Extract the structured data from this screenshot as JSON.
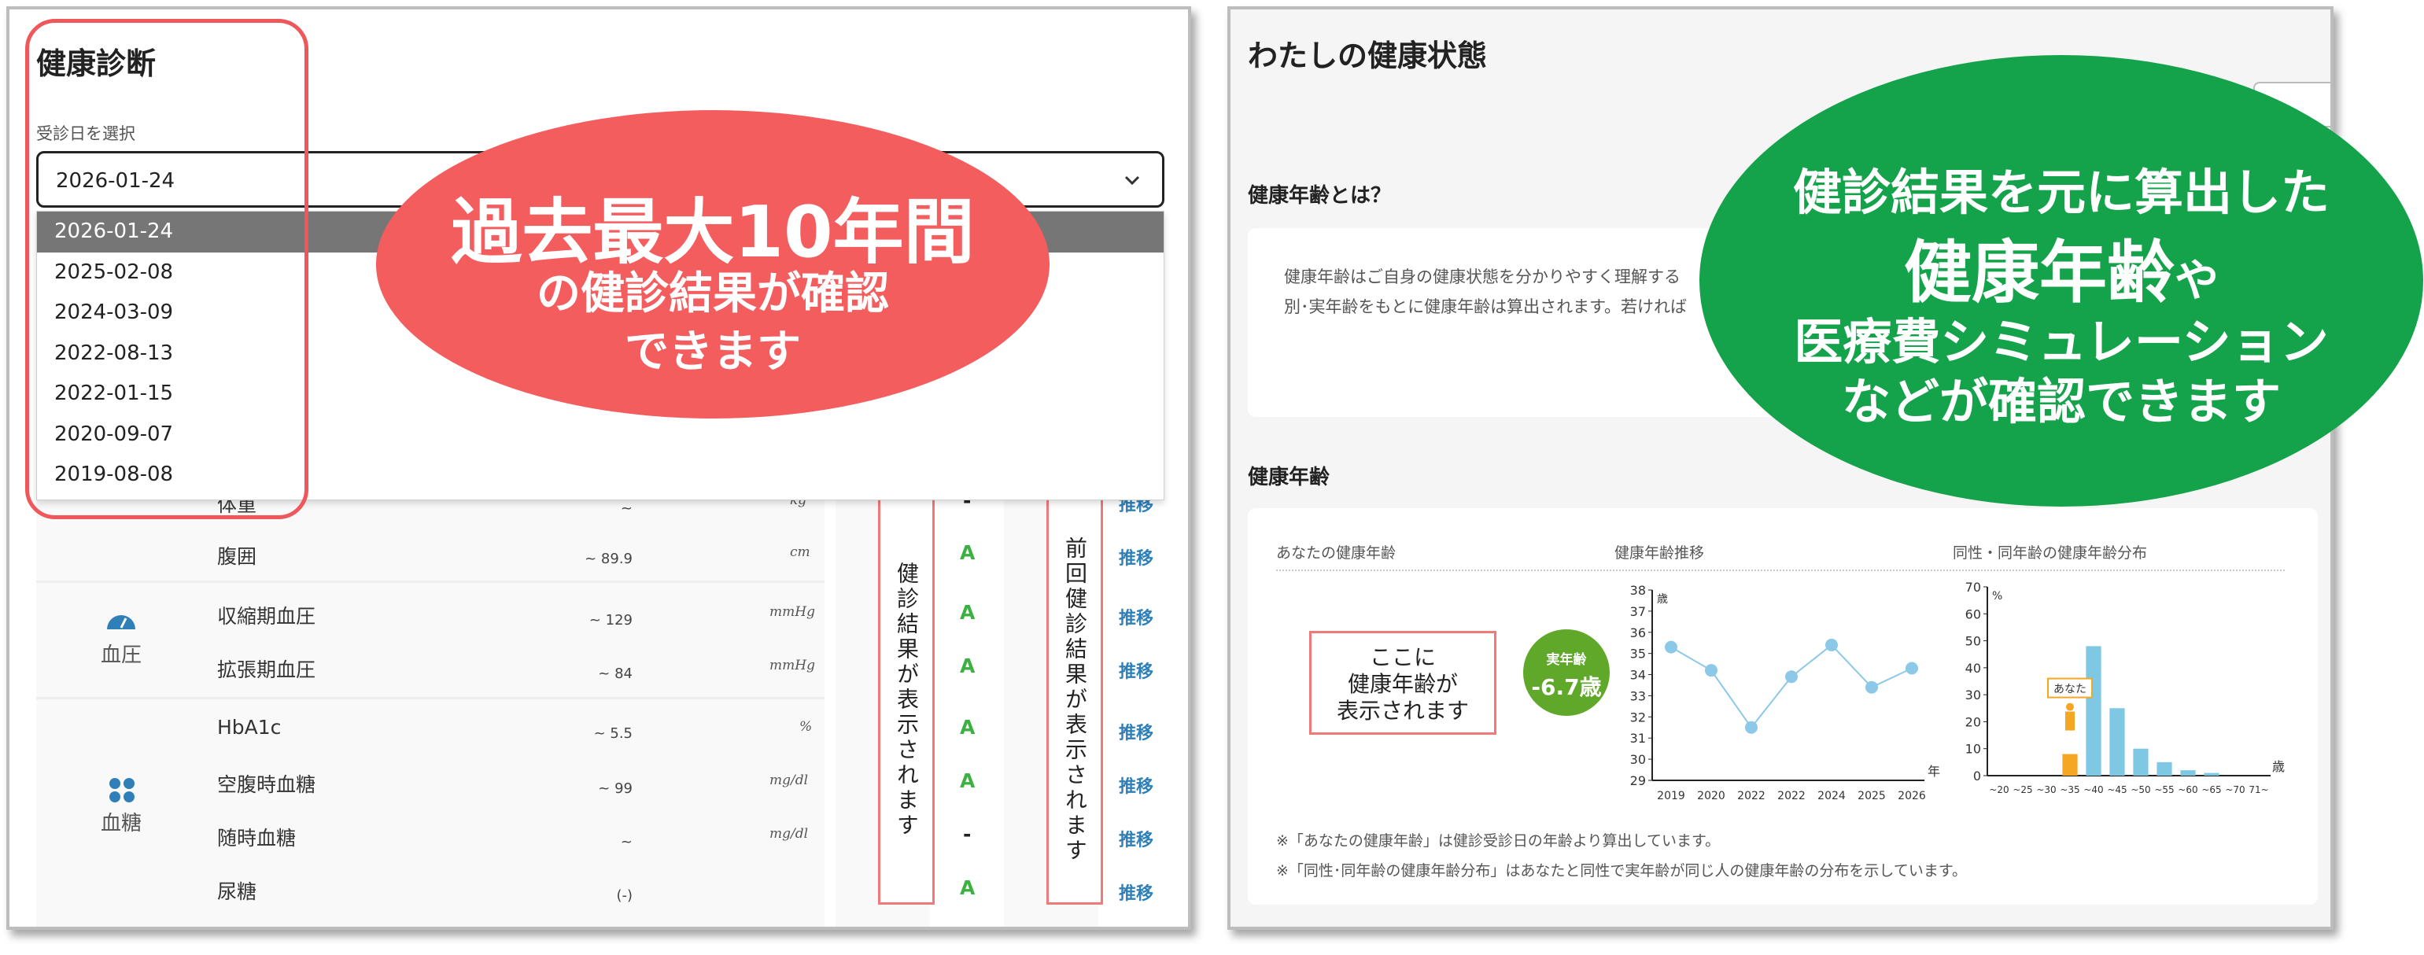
{
  "left": {
    "title": "健康診断",
    "date_label": "受診日を選択",
    "selected_date": "2026-01-24",
    "date_options": [
      "2026-01-24",
      "2025-02-08",
      "2024-03-09",
      "2022-08-13",
      "2022-01-15",
      "2020-09-07",
      "2019-08-08"
    ],
    "rows": [
      {
        "name": "体重",
        "range": "~",
        "unit": "kg",
        "grade": "-",
        "trend": "推移"
      },
      {
        "name": "腹囲",
        "range": "~ 89.9",
        "unit": "cm",
        "grade": "A",
        "trend": "推移"
      },
      {
        "name": "収縮期血圧",
        "range": "~ 129",
        "unit": "mmHg",
        "grade": "A",
        "trend": "推移"
      },
      {
        "name": "拡張期血圧",
        "range": "~ 84",
        "unit": "mmHg",
        "grade": "A",
        "trend": "推移"
      },
      {
        "name": "HbA1c",
        "range": "~ 5.5",
        "unit": "%",
        "grade": "A",
        "trend": "推移"
      },
      {
        "name": "空腹時血糖",
        "range": "~ 99",
        "unit": "mg/dl",
        "grade": "A",
        "trend": "推移"
      },
      {
        "name": "随時血糖",
        "range": "~",
        "unit": "mg/dl",
        "grade": "-",
        "trend": "推移"
      },
      {
        "name": "尿糖",
        "range": "(-)",
        "unit": "",
        "grade": "A",
        "trend": "推移"
      }
    ],
    "categories": {
      "blood_pressure": "血圧",
      "blood_sugar": "血糖"
    },
    "result_box": "健診結果が表示されます",
    "prev_box": "前回健診結果が表示されます",
    "callout": {
      "line1": "過去最大10年間",
      "line2": "の健診結果が確認",
      "line3": "できます"
    }
  },
  "right": {
    "title": "わたしの健康状態",
    "what_head": "健康年齢とは？",
    "what_text1": "健康年齢はご自身の健康状態を分かりやすく理解する",
    "what_text2": "別･実年齢をもとに健康年齢は算出されます。若ければ",
    "age_head": "健康年齢",
    "col1": "あなたの健康年齢",
    "col2": "健康年齢推移",
    "col3": "同性・同年齢の健康年齢分布",
    "placeholder": {
      "line1": "ここに",
      "line2": "健康年齢が",
      "line3": "表示されます"
    },
    "real_age": {
      "label": "実年齢",
      "value": "-6.7歳"
    },
    "you_label": "あなた",
    "note1": "※「あなたの健康年齢」は健診受診日の年齢より算出しています。",
    "note2": "※「同性･同年齢の健康年齢分布」はあなたと同性で実年齢が同じ人の健康年齢の分布を示しています。",
    "callout": {
      "line1": "健診結果を元に算出した",
      "line2a": "健康年齢",
      "line2b": "や",
      "line3": "医療費シミュレーション",
      "line4": "などが確認できます"
    }
  },
  "chart_data": [
    {
      "type": "line",
      "title": "健康年齢推移",
      "xlabel": "年",
      "ylabel": "歳",
      "categories": [
        "2019",
        "2020",
        "2022",
        "2022",
        "2024",
        "2025",
        "2026"
      ],
      "values": [
        35.3,
        34.2,
        31.5,
        33.9,
        35.4,
        33.4,
        34.3
      ],
      "ylim": [
        29,
        38
      ],
      "yticks": [
        29,
        30,
        31,
        32,
        33,
        34,
        35,
        36,
        37,
        38
      ],
      "color": "#8cc9e8"
    },
    {
      "type": "bar",
      "title": "同性・同年齢の健康年齢分布",
      "xlabel": "歳",
      "ylabel": "%",
      "categories": [
        "~20",
        "~25",
        "~30",
        "~35",
        "~40",
        "~45",
        "~50",
        "~55",
        "~60",
        "~65",
        "~70",
        "71~"
      ],
      "values": [
        0,
        0,
        0,
        8,
        48,
        25,
        10,
        5,
        2,
        1,
        0,
        0
      ],
      "highlight_index": 3,
      "highlight_color": "#f5a623",
      "color": "#7ec8e3",
      "ylim": [
        0,
        70
      ],
      "yticks": [
        0,
        10,
        20,
        30,
        40,
        50,
        60,
        70
      ]
    }
  ]
}
